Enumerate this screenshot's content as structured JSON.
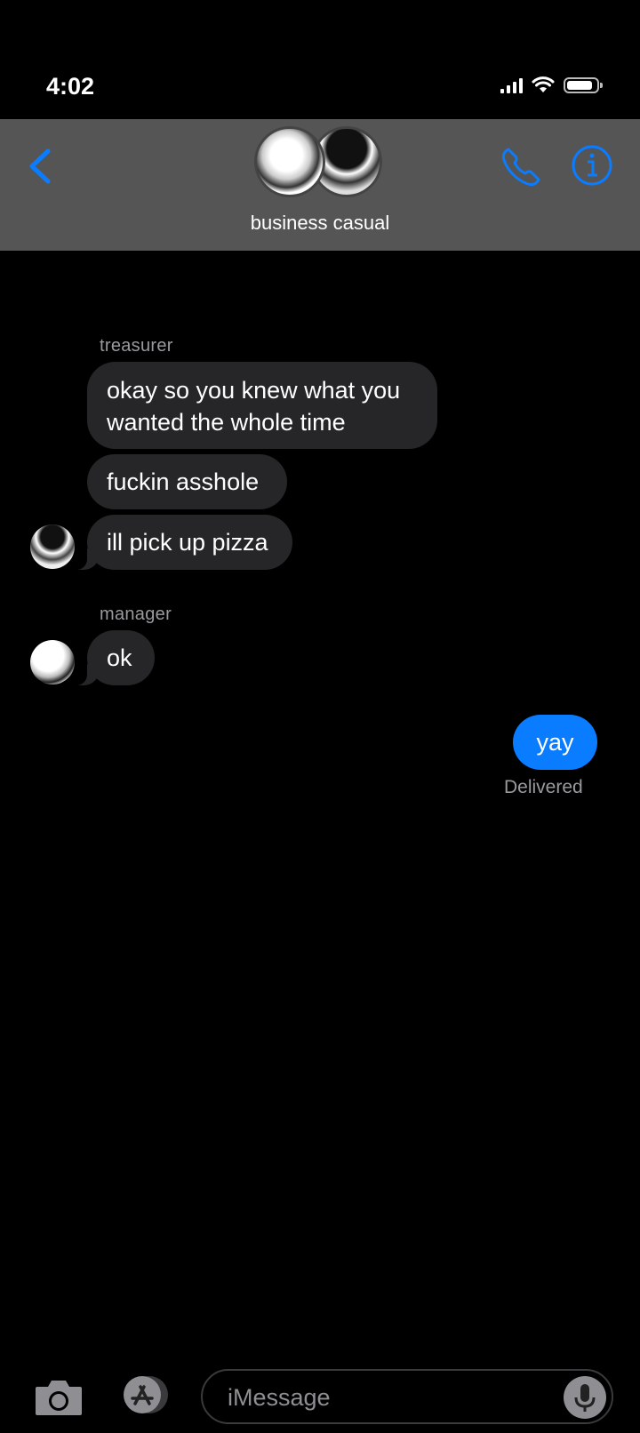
{
  "status_bar": {
    "time": "4:02"
  },
  "header": {
    "back_icon": "chevron-left-icon",
    "group_name": "business casual",
    "call_icon": "phone-icon",
    "info_icon": "info-icon",
    "accent_color": "#0a7cff"
  },
  "messages": [
    {
      "sender": "treasurer"
    },
    {
      "text": "okay so you knew what you wanted the whole time"
    },
    {
      "text": "fuckin asshole"
    },
    {
      "text": "ill pick up pizza"
    },
    {
      "sender": "manager"
    },
    {
      "text": "ok"
    },
    {
      "text": "yay",
      "status": "Delivered"
    }
  ],
  "composer": {
    "placeholder": "iMessage",
    "camera_icon": "camera-icon",
    "appstore_icon": "app-store-icon",
    "mic_icon": "microphone-icon"
  }
}
